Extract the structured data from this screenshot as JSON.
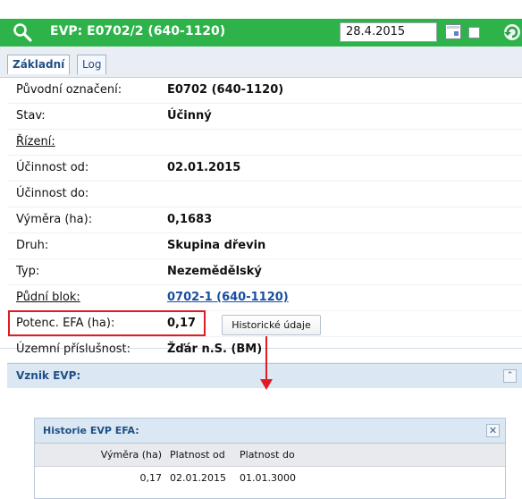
{
  "header": {
    "title": "EVP: E0702/2 (640-1120)",
    "date_value": "28.4.2015",
    "accent_color": "#2db34a"
  },
  "tabs": [
    {
      "label": "Základní",
      "active": true
    },
    {
      "label": "Log",
      "active": false
    }
  ],
  "fields": [
    {
      "label": "Původní označení:",
      "value": "E0702 (640-1120)",
      "link_label": false,
      "link_value": false
    },
    {
      "label": "Stav:",
      "value": "Účinný",
      "link_label": false,
      "link_value": false
    },
    {
      "label": "Řízení:",
      "value": "",
      "link_label": true,
      "link_value": false
    },
    {
      "label": "Účinnost od:",
      "value": "02.01.2015",
      "link_label": false,
      "link_value": false
    },
    {
      "label": "Účinnost do:",
      "value": "",
      "link_label": false,
      "link_value": false
    },
    {
      "label": "Výměra (ha):",
      "value": "0,1683",
      "link_label": false,
      "link_value": false
    },
    {
      "label": "Druh:",
      "value": "Skupina dřevin",
      "link_label": false,
      "link_value": false
    },
    {
      "label": "Typ:",
      "value": "Nezemědělský",
      "link_label": false,
      "link_value": false
    },
    {
      "label": "Půdní blok:",
      "value": "0702-1 (640-1120)",
      "link_label": true,
      "link_value": true
    },
    {
      "label": "Potenc. EFA (ha):",
      "value": "0,17",
      "link_label": false,
      "link_value": false
    },
    {
      "label": "Územní příslušnost:",
      "value": "Žďár n.S. (BM)",
      "link_label": false,
      "link_value": false
    }
  ],
  "historical_button": "Historické údaje",
  "section": {
    "title": "Vznik EVP:"
  },
  "popup": {
    "title": "Historie EVP EFA:",
    "columns": [
      "Výměra (ha)",
      "Platnost od",
      "Platnost do"
    ],
    "rows": [
      [
        "0,17",
        "02.01.2015",
        "01.01.3000"
      ]
    ]
  },
  "icons": {
    "search": "search-icon",
    "calendar": "calendar-icon",
    "refresh": "refresh-icon",
    "collapse": "chevron-up-icon",
    "close": "close-icon"
  },
  "highlight_color": "#e01b24"
}
